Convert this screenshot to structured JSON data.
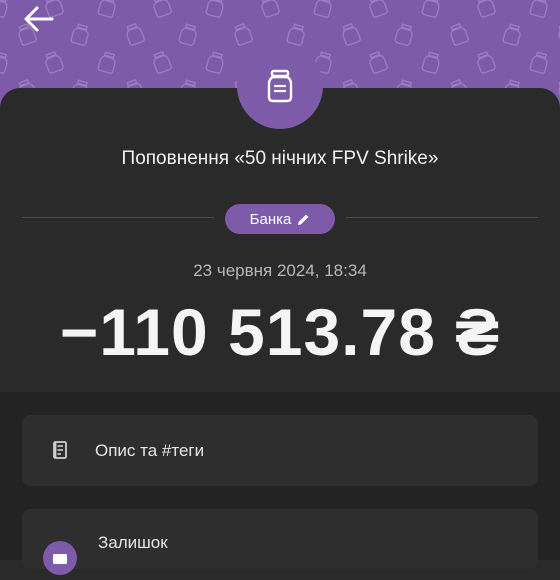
{
  "colors": {
    "accent": "#7e5ba8",
    "background": "#2a2a2a",
    "surface": "#2e2e2e"
  },
  "header": {
    "back_icon": "arrow-left-icon"
  },
  "transaction": {
    "icon": "jar-icon",
    "title": "Поповнення «50 нічних FPV Shrike»",
    "category_label": "Банка",
    "category_icon": "pencil-icon",
    "datetime": "23 червня 2024, 18:34",
    "amount": "−110 513.78 ₴"
  },
  "rows": {
    "description": {
      "icon": "note-icon",
      "label": "Опис та #теги"
    },
    "balance": {
      "icon": "wallet-icon",
      "label": "Залишок"
    }
  }
}
